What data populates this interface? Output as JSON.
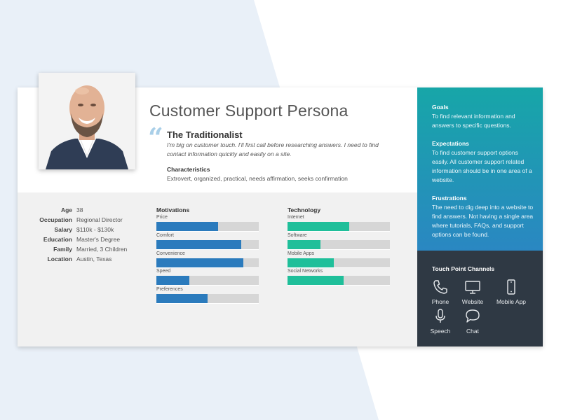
{
  "colors": {
    "background_shape": "#e9f0f8",
    "motivation_bar": "#2b7bbd",
    "technology_bar": "#1fbf9a",
    "bar_track": "#d6d6d6",
    "gradient_top": "#17a6a8",
    "gradient_bottom": "#2a87c2",
    "dark_panel": "#2f3944"
  },
  "header": {
    "title": "Customer Support Persona",
    "subtitle": "The Traditionalist",
    "quote": "I'm big on customer touch. I'll first call before researching answers. I need to find contact information quickly and easily on a site.",
    "characteristics_heading": "Characteristics",
    "characteristics_text": "Extrovert, organized, practical, needs affirmation, seeks confirmation"
  },
  "profile": [
    {
      "label": "Age",
      "value": "38"
    },
    {
      "label": "Occupation",
      "value": "Regional Director"
    },
    {
      "label": "Salary",
      "value": "$110k - $130k"
    },
    {
      "label": "Education",
      "value": "Master's Degree"
    },
    {
      "label": "Family",
      "value": "Married, 3 Children"
    },
    {
      "label": "Location",
      "value": "Austin, Texas"
    }
  ],
  "motivations": {
    "heading": "Motivations",
    "items": [
      {
        "label": "Price",
        "level": 0.6
      },
      {
        "label": "Comfort",
        "level": 0.83
      },
      {
        "label": "Convenience",
        "level": 0.85
      },
      {
        "label": "Speed",
        "level": 0.32
      },
      {
        "label": "Preferences",
        "level": 0.5
      }
    ]
  },
  "technology": {
    "heading": "Technology",
    "items": [
      {
        "label": "Internet",
        "level": 0.6
      },
      {
        "label": "Software",
        "level": 0.32
      },
      {
        "label": "Mobile Apps",
        "level": 0.45
      },
      {
        "label": "Social Networks",
        "level": 0.55
      }
    ]
  },
  "goals": {
    "heading": "Goals",
    "text": "To find relevant information and answers to specific questions."
  },
  "expectations": {
    "heading": "Expectations",
    "text": "To find customer support options easily. All customer support related information should be in one area of a website."
  },
  "frustrations": {
    "heading": "Frustrations",
    "text": "The need to dig deep into a website to find answers. Not having a single area where tutorials, FAQs, and support options can be found."
  },
  "touch_points": {
    "heading": "Touch Point Channels",
    "channels": [
      {
        "label": "Phone",
        "icon": "phone-icon"
      },
      {
        "label": "Website",
        "icon": "monitor-icon"
      },
      {
        "label": "Mobile App",
        "icon": "smartphone-icon"
      },
      {
        "label": "Speech",
        "icon": "microphone-icon"
      },
      {
        "label": "Chat",
        "icon": "chat-bubble-icon"
      }
    ]
  }
}
